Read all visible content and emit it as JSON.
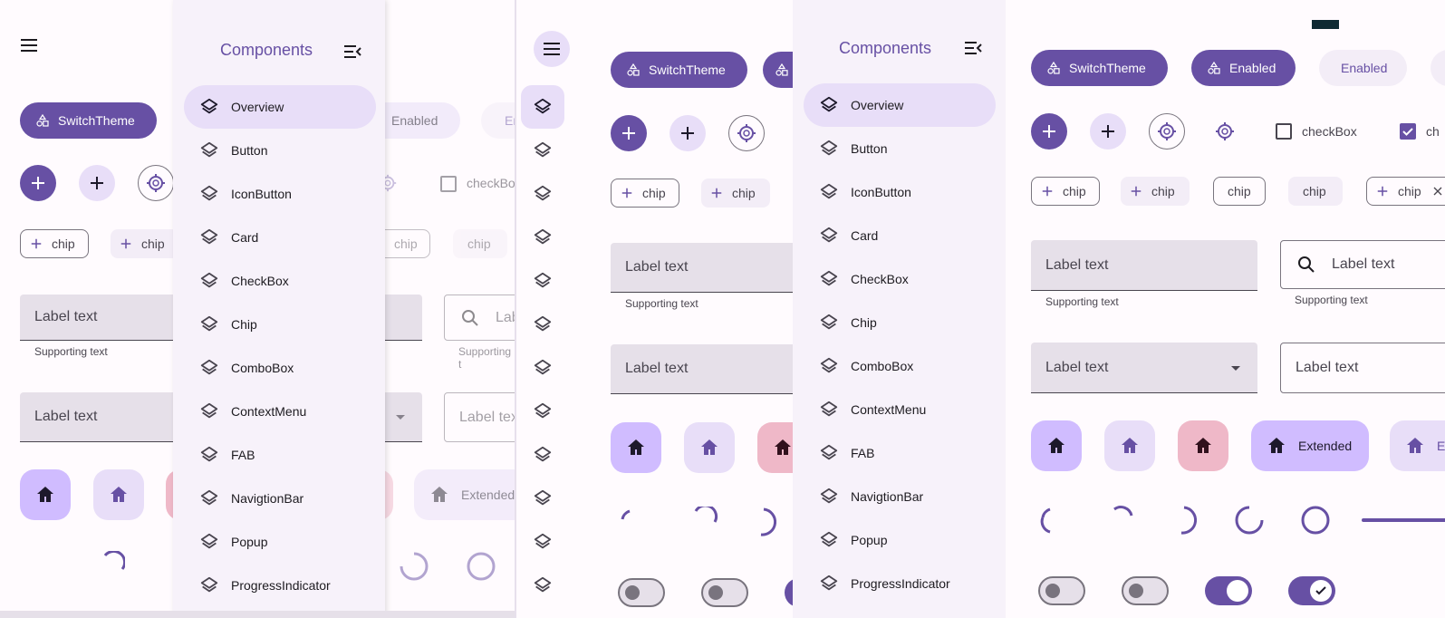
{
  "drawer": {
    "title": "Components",
    "items": [
      "Overview",
      "Button",
      "IconButton",
      "Card",
      "CheckBox",
      "Chip",
      "ComboBox",
      "ContextMenu",
      "FAB",
      "NavigtionBar",
      "Popup",
      "ProgressIndicator"
    ],
    "selected": "Overview"
  },
  "buttons": {
    "switch_theme": "SwitchTheme",
    "enabled": "Enabled",
    "enabled_soft": "Enabled",
    "enabled_cut": "Er",
    "extended": "Extended",
    "extended_cut": "E"
  },
  "checkbox": {
    "label": "checkBox",
    "label_cut": "ch"
  },
  "chips": {
    "label": "chip"
  },
  "fields": {
    "label": "Label text",
    "label_cut_a": "Lab",
    "label_cut_b": "Label tex",
    "supporting": "Supporting text",
    "supporting_cut": "Supporting t"
  },
  "colors": {
    "primary": "#6750a4",
    "primary_container": "#e8def8",
    "surface": "#fffbfe",
    "surface_container": "#f7f2fa",
    "field_fill": "#e6e0e9",
    "tertiary_container": "#efb8c8",
    "on_surface": "#1d1b20"
  },
  "icons": [
    "menu-icon",
    "menu-open-icon",
    "layers-icon",
    "add-icon",
    "gps-icon",
    "search-icon",
    "home-icon",
    "dropdown-arrow-icon",
    "close-icon",
    "check-icon",
    "shapes-icon"
  ]
}
